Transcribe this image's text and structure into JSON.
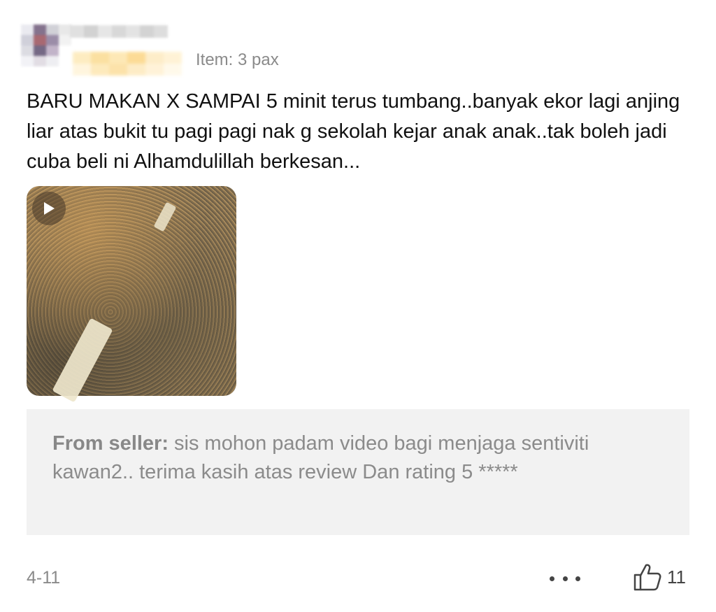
{
  "review": {
    "item_label": "Item: 3 pax",
    "text": "BARU MAKAN X SAMPAI 5 minit terus tumbang..banyak ekor lagi anjing liar atas bukit tu pagi pagi nak g sekolah kejar anak anak..tak boleh jadi cuba beli ni Alhamdulillah berkesan...",
    "media": {
      "type": "video",
      "icon": "play-icon"
    },
    "seller_reply": {
      "prefix": "From seller:",
      "text": " sis mohon padam video bagi menjaga sentiviti kawan2.. terima kasih atas review Dan rating 5 *****"
    },
    "date": "4-11",
    "more_icon": "more-dots-icon",
    "like": {
      "icon": "thumbs-up-icon",
      "count": "11"
    }
  },
  "colors": {
    "text": "#111111",
    "muted": "#8a8a8a",
    "seller_box_bg": "#f2f2f2"
  }
}
